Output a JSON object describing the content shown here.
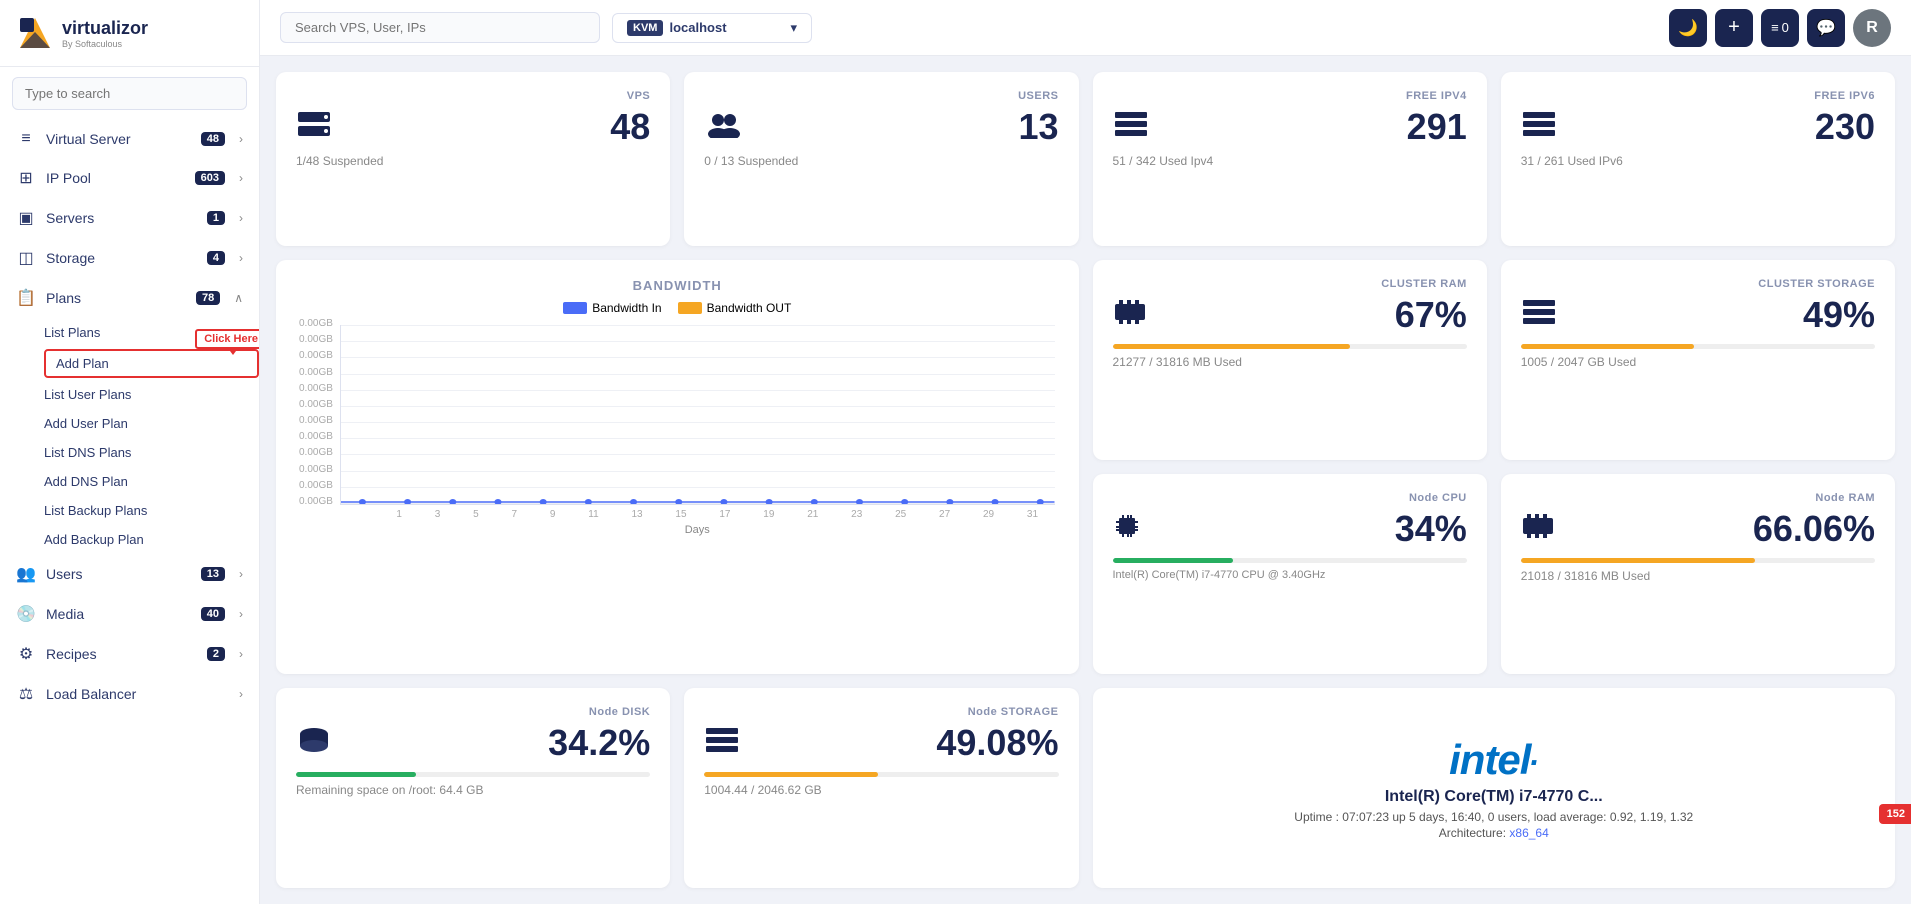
{
  "sidebar": {
    "logo_title": "virtualizor",
    "logo_sub": "By Softaculous",
    "search_placeholder": "Type to search",
    "nav_items": [
      {
        "label": "Virtual Server",
        "badge": "48",
        "icon": "≡",
        "has_arrow": true
      },
      {
        "label": "IP Pool",
        "badge": "603",
        "icon": "⊞",
        "has_arrow": true
      },
      {
        "label": "Servers",
        "badge": "1",
        "icon": "▣",
        "has_arrow": true
      },
      {
        "label": "Storage",
        "badge": "4",
        "icon": "◫",
        "has_arrow": true
      },
      {
        "label": "Plans",
        "badge": "78",
        "icon": "📋",
        "has_arrow": false,
        "expanded": true
      }
    ],
    "plans_subnav": [
      {
        "label": "List Plans",
        "highlighted": false
      },
      {
        "label": "Add Plan",
        "highlighted": true
      },
      {
        "label": "List User Plans",
        "highlighted": false
      },
      {
        "label": "Add User Plan",
        "highlighted": false
      },
      {
        "label": "List DNS Plans",
        "highlighted": false
      },
      {
        "label": "Add DNS Plan",
        "highlighted": false
      },
      {
        "label": "List Backup Plans",
        "highlighted": false
      },
      {
        "label": "Add Backup Plan",
        "highlighted": false
      }
    ],
    "nav_items2": [
      {
        "label": "Users",
        "badge": "13",
        "icon": "👥",
        "has_arrow": true
      },
      {
        "label": "Media",
        "badge": "40",
        "icon": "💿",
        "has_arrow": true
      },
      {
        "label": "Recipes",
        "badge": "2",
        "icon": "⚙",
        "has_arrow": true
      },
      {
        "label": "Load Balancer",
        "badge": "",
        "icon": "⚖",
        "has_arrow": true
      }
    ]
  },
  "header": {
    "search_placeholder": "Search VPS, User, IPs",
    "kvm_label": "KVM",
    "server_name": "localhost",
    "dark_mode_icon": "🌙",
    "add_icon": "+",
    "list_icon": "≡",
    "notif_count": "0",
    "chat_icon": "💬",
    "avatar_label": "R"
  },
  "stats": {
    "vps": {
      "label": "VPS",
      "value": "48",
      "sub": "1/48 Suspended",
      "icon": "server"
    },
    "users": {
      "label": "USERS",
      "value": "13",
      "sub": "0 / 13 Suspended",
      "icon": "users"
    },
    "ipv4": {
      "label": "FREE IPV4",
      "value": "291",
      "sub": "51 / 342 Used Ipv4",
      "icon": "stack"
    },
    "ipv6": {
      "label": "FREE IPV6",
      "value": "230",
      "sub": "31 / 261 Used IPv6",
      "icon": "stack"
    },
    "cluster_ram": {
      "label": "CLUSTER RAM",
      "value": "67%",
      "progress": 67,
      "progress_color": "orange",
      "sub": "21277 / 31816 MB Used",
      "icon": "ram"
    },
    "cluster_storage": {
      "label": "CLUSTER STORAGE",
      "value": "49%",
      "progress": 49,
      "progress_color": "orange",
      "sub": "1005 / 2047 GB Used",
      "icon": "hdd"
    },
    "node_cpu": {
      "label": "Node CPU",
      "value": "34%",
      "progress": 34,
      "progress_color": "green",
      "sub": "Intel(R) Core(TM) i7-4770 CPU @ 3.40GHz",
      "icon": "cpu"
    },
    "node_ram": {
      "label": "Node RAM",
      "value": "66.06%",
      "progress": 66,
      "progress_color": "orange",
      "sub": "21018 / 31816 MB Used",
      "icon": "ram"
    },
    "node_disk": {
      "label": "Node DISK",
      "value": "34.2%",
      "progress": 34,
      "progress_color": "green",
      "sub": "Remaining space on /root: 64.4 GB",
      "icon": "hdd"
    },
    "node_storage": {
      "label": "Node STORAGE",
      "value": "49.08%",
      "progress": 49,
      "progress_color": "orange",
      "sub": "1004.44 / 2046.62 GB",
      "icon": "stack"
    }
  },
  "bandwidth": {
    "title": "BANDWIDTH",
    "legend_in": "Bandwidth In",
    "legend_out": "Bandwidth OUT",
    "y_labels": [
      "0.00GB",
      "0.00GB",
      "0.00GB",
      "0.00GB",
      "0.00GB",
      "0.00GB",
      "0.00GB",
      "0.00GB",
      "0.00GB",
      "0.00GB",
      "0.00GB",
      "0.00GB"
    ],
    "x_labels": [
      "1",
      "3",
      "5",
      "7",
      "9",
      "11",
      "13",
      "15",
      "17",
      "19",
      "21",
      "23",
      "25",
      "27",
      "29",
      "31"
    ],
    "x_title": "Days"
  },
  "intel": {
    "logo": "intel",
    "name": "Intel(R) Core(TM) i7-4770 C...",
    "uptime": "Uptime : 07:07:23 up 5 days, 16:40, 0 users, load average: 0.92, 1.19, 1.32",
    "arch_label": "Architecture:",
    "arch_value": "x86_64"
  },
  "floating_notif": "152",
  "click_here_label": "Click Here"
}
